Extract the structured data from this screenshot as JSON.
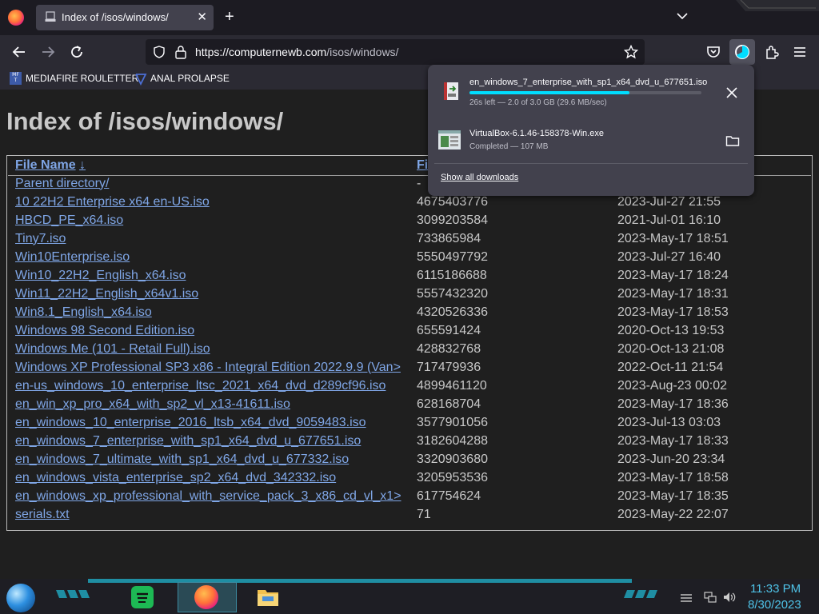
{
  "browser": {
    "tab": {
      "title": "Index of /isos/windows/"
    },
    "url": {
      "host": "https://computernewb.com",
      "path": "/isos/windows/"
    },
    "bookmarks": [
      {
        "label": "MEDIAFIRE ROULETTER"
      },
      {
        "label": "ANAL PROLAPSE"
      }
    ],
    "bookmark_icon_text": "MF\nT"
  },
  "page": {
    "heading": "Index of /isos/windows/",
    "columns": {
      "name": "File Name",
      "sort_arrow": "↓",
      "size": "Fi",
      "date": ""
    },
    "rows": [
      {
        "name": "Parent directory/",
        "size": "-",
        "date": ""
      },
      {
        "name": "10 22H2 Enterprise x64 en-US.iso",
        "size": "4675403776",
        "date": "2023-Jul-27 21:55"
      },
      {
        "name": "HBCD_PE_x64.iso",
        "size": "3099203584",
        "date": "2021-Jul-01 16:10"
      },
      {
        "name": "Tiny7.iso",
        "size": "733865984",
        "date": "2023-May-17 18:51"
      },
      {
        "name": "Win10Enterprise.iso",
        "size": "5550497792",
        "date": "2023-Jul-27 16:40"
      },
      {
        "name": "Win10_22H2_English_x64.iso",
        "size": "6115186688",
        "date": "2023-May-17 18:24"
      },
      {
        "name": "Win11_22H2_English_x64v1.iso",
        "size": "5557432320",
        "date": "2023-May-17 18:31"
      },
      {
        "name": "Win8.1_English_x64.iso",
        "size": "4320526336",
        "date": "2023-May-17 18:53"
      },
      {
        "name": "Windows 98 Second Edition.iso",
        "size": "655591424",
        "date": "2020-Oct-13 19:53"
      },
      {
        "name": "Windows Me (101 - Retail Full).iso",
        "size": "428832768",
        "date": "2020-Oct-13 21:08"
      },
      {
        "name": "Windows XP Professional SP3 x86 - Integral Edition 2022.9.9 (Van>",
        "size": "717479936",
        "date": "2022-Oct-11 21:54"
      },
      {
        "name": "en-us_windows_10_enterprise_ltsc_2021_x64_dvd_d289cf96.iso",
        "size": "4899461120",
        "date": "2023-Aug-23 00:02"
      },
      {
        "name": "en_win_xp_pro_x64_with_sp2_vl_x13-41611.iso",
        "size": "628168704",
        "date": "2023-May-17 18:36"
      },
      {
        "name": "en_windows_10_enterprise_2016_ltsb_x64_dvd_9059483.iso",
        "size": "3577901056",
        "date": "2023-Jul-13 03:03"
      },
      {
        "name": "en_windows_7_enterprise_with_sp1_x64_dvd_u_677651.iso",
        "size": "3182604288",
        "date": "2023-May-17 18:33"
      },
      {
        "name": "en_windows_7_ultimate_with_sp1_x64_dvd_u_677332.iso",
        "size": "3320903680",
        "date": "2023-Jun-20 23:34"
      },
      {
        "name": "en_windows_vista_enterprise_sp2_x64_dvd_342332.iso",
        "size": "3205953536",
        "date": "2023-May-17 18:58"
      },
      {
        "name": "en_windows_xp_professional_with_service_pack_3_x86_cd_vl_x1>",
        "size": "617754624",
        "date": "2023-May-17 18:35"
      },
      {
        "name": "serials.txt",
        "size": "71",
        "date": "2023-May-22 22:07"
      }
    ]
  },
  "downloads": {
    "items": [
      {
        "name": "en_windows_7_enterprise_with_sp1_x64_dvd_u_677651.iso",
        "status": "26s left — 2.0 of 3.0 GB (29.6 MB/sec)",
        "progress": 0.69
      },
      {
        "name": "VirtualBox-6.1.46-158378-Win.exe",
        "status": "Completed — 107 MB"
      }
    ],
    "show_all_label": "Show all downloads"
  },
  "taskbar": {
    "time": "11:33 PM",
    "date": "8/30/2023"
  },
  "colors": {
    "accent": "#00ddff",
    "link": "#7fa6e6",
    "clock": "#4fc3e8"
  }
}
